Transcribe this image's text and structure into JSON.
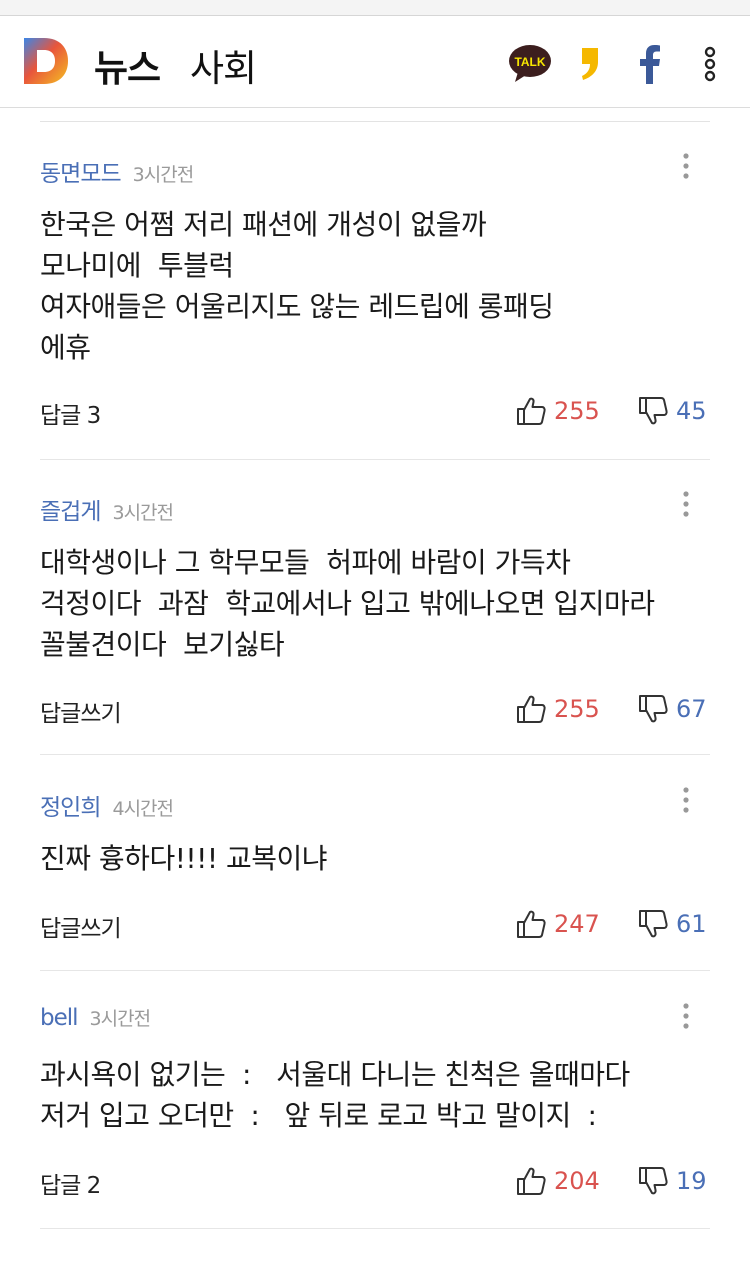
{
  "header": {
    "site_title": "뉴스",
    "section_title": "사회",
    "talk_icon_text": "TALK",
    "logo_letter": "D"
  },
  "colors": {
    "author": "#4a6fb6",
    "like": "#d9534f",
    "dislike": "#4a6fb6"
  },
  "comments": [
    {
      "author": "동면모드",
      "time": "3시간전",
      "lines": [
        "한국은 어쩜 저리 패션에 개성이 없을까",
        "모나미에  투블럭",
        "여자애들은 어울리지도 않는 레드립에 롱패딩",
        "에휴"
      ],
      "reply": "답글 3",
      "likes": "255",
      "dislikes": "45"
    },
    {
      "author": "즐겁게",
      "time": "3시간전",
      "lines": [
        "대학생이나 그 학무모들  허파에 바람이 가득차",
        "걱정이다  과잠  학교에서나 입고 밖에나오면 입지마라",
        "꼴불견이다  보기싫타"
      ],
      "reply": "답글쓰기",
      "likes": "255",
      "dislikes": "67"
    },
    {
      "author": "정인희",
      "time": "4시간전",
      "lines": [
        "진짜 흉하다!!!! 교복이냐"
      ],
      "reply": "답글쓰기",
      "likes": "247",
      "dislikes": "61"
    },
    {
      "author": "bell",
      "time": "3시간전",
      "lines": [
        "과시욕이 없기는  :   서울대 다니는 친척은 올때마다",
        "저거 입고 오더만  :   앞 뒤로 로고 박고 말이지  :"
      ],
      "reply": "답글 2",
      "likes": "204",
      "dislikes": "19"
    }
  ]
}
